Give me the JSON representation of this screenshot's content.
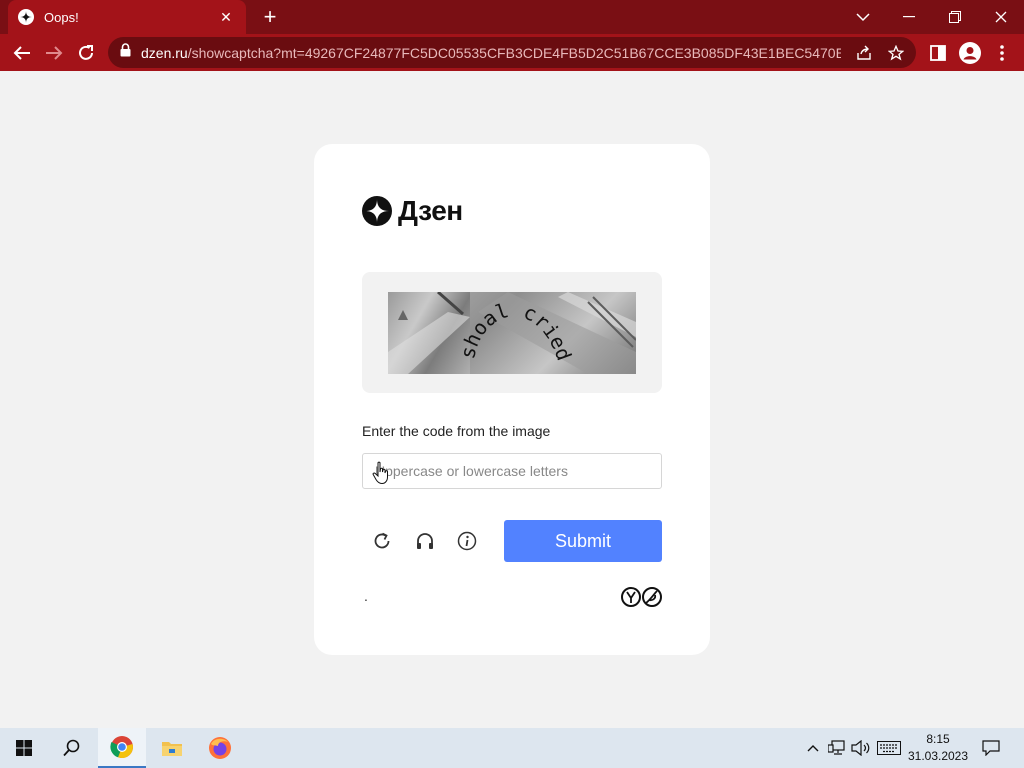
{
  "browser": {
    "tab_title": "Oops!",
    "url_host": "dzen.ru",
    "url_path": "/showcaptcha?mt=49267CF24877FC5DC05535CFB3CDE4FB5D2C51B67CCE3B085DF43E1BEC5470E22870...",
    "accent_color": "#a31319"
  },
  "card": {
    "brand_name": "Дзен",
    "captcha_text": "shoal cried",
    "prompt": "Enter the code from the image",
    "input_placeholder": "Uppercase or lowercase letters",
    "input_value": "",
    "submit_label": "Submit",
    "footer_mark": ".",
    "submit_color": "#5282ff"
  },
  "taskbar": {
    "time": "8:15",
    "date": "31.03.2023"
  }
}
